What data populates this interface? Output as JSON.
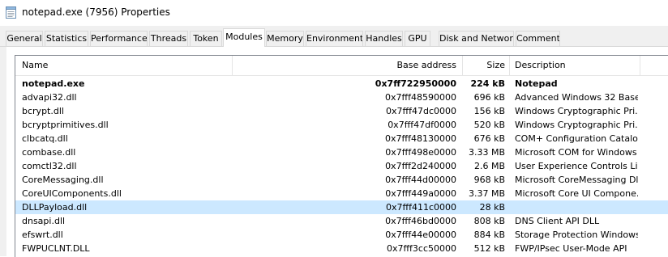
{
  "window": {
    "title": "notepad.exe (7956) Properties",
    "icon": "notepad-icon"
  },
  "tabs": [
    {
      "label": "General"
    },
    {
      "label": "Statistics"
    },
    {
      "label": "Performance"
    },
    {
      "label": "Threads"
    },
    {
      "label": "Token"
    },
    {
      "label": "Modules",
      "active": true
    },
    {
      "label": "Memory"
    },
    {
      "label": "Environment"
    },
    {
      "label": "Handles"
    },
    {
      "label": "GPU"
    },
    {
      "label": "Disk and Network"
    },
    {
      "label": "Comment"
    }
  ],
  "modules": {
    "columns": {
      "name": "Name",
      "base_address": "Base address",
      "size": "Size",
      "description": "Description"
    },
    "selected_row": 9,
    "rows": [
      {
        "name": "notepad.exe",
        "base": "0x7ff722950000",
        "size": "224 kB",
        "desc": "Notepad",
        "bold": true
      },
      {
        "name": "advapi32.dll",
        "base": "0x7fff48590000",
        "size": "696 kB",
        "desc": "Advanced Windows 32 Base..."
      },
      {
        "name": "bcrypt.dll",
        "base": "0x7fff47dc0000",
        "size": "156 kB",
        "desc": "Windows Cryptographic Pri..."
      },
      {
        "name": "bcryptprimitives.dll",
        "base": "0x7fff47df0000",
        "size": "520 kB",
        "desc": "Windows Cryptographic Pri..."
      },
      {
        "name": "clbcatq.dll",
        "base": "0x7fff48130000",
        "size": "676 kB",
        "desc": "COM+ Configuration Catalog"
      },
      {
        "name": "combase.dll",
        "base": "0x7fff498e0000",
        "size": "3.33 MB",
        "desc": "Microsoft COM for Windows"
      },
      {
        "name": "comctl32.dll",
        "base": "0x7fff2d240000",
        "size": "2.6 MB",
        "desc": "User Experience Controls Li..."
      },
      {
        "name": "CoreMessaging.dll",
        "base": "0x7fff44d00000",
        "size": "968 kB",
        "desc": "Microsoft CoreMessaging Dll"
      },
      {
        "name": "CoreUIComponents.dll",
        "base": "0x7fff449a0000",
        "size": "3.37 MB",
        "desc": "Microsoft Core UI Compone..."
      },
      {
        "name": "DLLPayload.dll",
        "base": "0x7fff411c0000",
        "size": "28 kB",
        "desc": ""
      },
      {
        "name": "dnsapi.dll",
        "base": "0x7fff46bd0000",
        "size": "808 kB",
        "desc": "DNS Client API DLL"
      },
      {
        "name": "efswrt.dll",
        "base": "0x7fff44e00000",
        "size": "884 kB",
        "desc": "Storage Protection Windows..."
      },
      {
        "name": "FWPUCLNT.DLL",
        "base": "0x7fff3cc50000",
        "size": "512 kB",
        "desc": "FWP/IPsec User-Mode API"
      }
    ]
  }
}
